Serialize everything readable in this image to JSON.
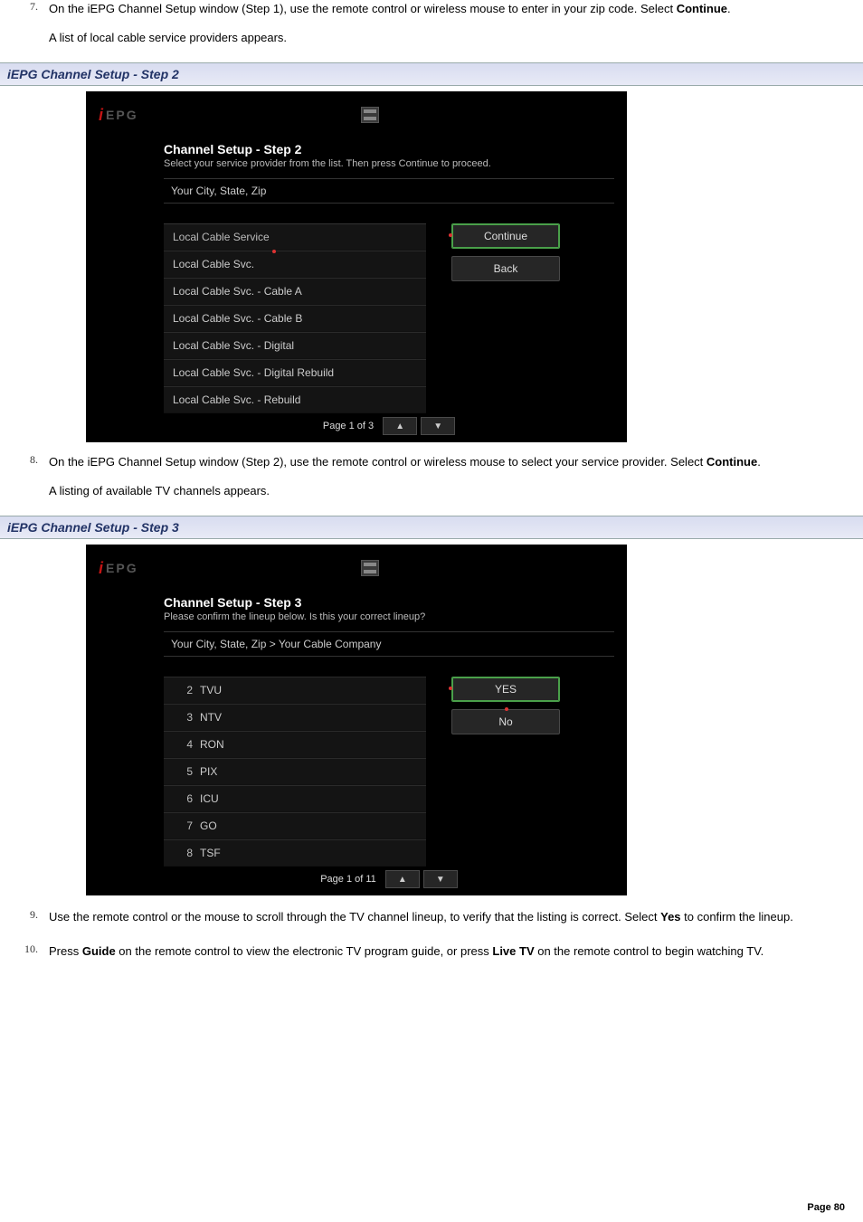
{
  "steps": {
    "7": {
      "num": "7.",
      "text_before": "On the iEPG Channel Setup window (Step 1), use the remote control or wireless mouse to enter in your zip code. Select ",
      "bold": "Continue",
      "text_after": ".",
      "follow": "A list of local cable service providers appears."
    },
    "8": {
      "num": "8.",
      "text_before": "On the iEPG Channel Setup window (Step 2), use the remote control or wireless mouse to select your service provider. Select ",
      "bold": "Continue",
      "text_after": ".",
      "follow": "A listing of available TV channels appears."
    },
    "9": {
      "num": "9.",
      "text_before": "Use the remote control or the mouse to scroll through the TV channel lineup, to verify that the listing is correct. Select ",
      "bold": "Yes",
      "text_after": " to confirm the lineup."
    },
    "10": {
      "num": "10.",
      "p1": "Press ",
      "b1": "Guide",
      "p2": " on the remote control to view the electronic TV program guide, or press ",
      "b2": "Live TV",
      "p3": " on the remote control to begin watching TV."
    }
  },
  "headers": {
    "step2": "iEPG Channel Setup - Step 2",
    "step3": "iEPG Channel Setup - Step 3"
  },
  "logo": {
    "i": "i",
    "epg": "EPG"
  },
  "panel2": {
    "title": "Channel Setup - Step 2",
    "sub": "Select your service provider from the list. Then press Continue to proceed.",
    "breadcrumb": "Your City, State, Zip",
    "list_header": "Local Cable Service",
    "items": [
      "Local Cable Svc.",
      "Local Cable Svc.    - Cable A",
      "Local Cable Svc.    - Cable B",
      "Local Cable Svc.    - Digital",
      "Local Cable Svc.    - Digital Rebuild",
      "Local Cable Svc.    - Rebuild"
    ],
    "btn_continue": "Continue",
    "btn_back": "Back",
    "pager": "Page 1 of 3"
  },
  "panel3": {
    "title": "Channel Setup - Step 3",
    "sub": "Please confirm the lineup below. Is this your correct lineup?",
    "breadcrumb": "Your City, State, Zip  >  Your Cable Company",
    "channels": [
      {
        "num": "2",
        "name": "TVU"
      },
      {
        "num": "3",
        "name": "NTV"
      },
      {
        "num": "4",
        "name": "RON"
      },
      {
        "num": "5",
        "name": "PIX"
      },
      {
        "num": "6",
        "name": "ICU"
      },
      {
        "num": "7",
        "name": "GO"
      },
      {
        "num": "8",
        "name": "TSF"
      }
    ],
    "btn_yes": "YES",
    "btn_no": "No",
    "pager": "Page 1 of 11"
  },
  "pager_icons": {
    "up": "▲",
    "down": "▼"
  },
  "footer": "Page 80"
}
